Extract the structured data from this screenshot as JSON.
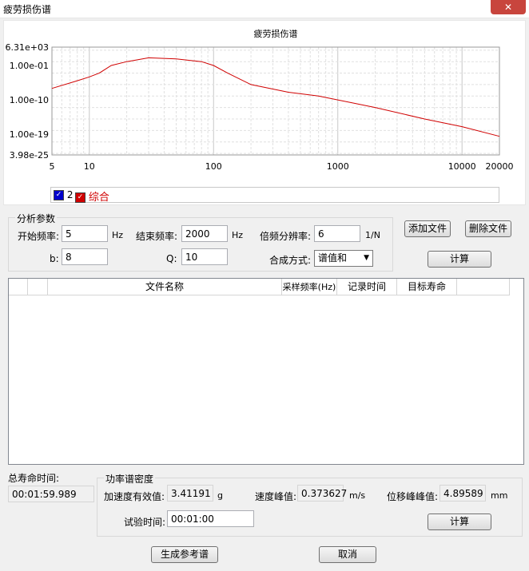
{
  "window": {
    "title": "疲劳损伤谱",
    "close_icon": "close-icon"
  },
  "chart_data": {
    "type": "line",
    "title": "疲劳损伤谱",
    "x_scale": "log",
    "y_scale": "log",
    "xlim": [
      5,
      20000
    ],
    "ylim": [
      3.98e-25,
      6310.0
    ],
    "x_ticks": [
      "5",
      "10",
      "100",
      "1000",
      "10000",
      "20000"
    ],
    "y_ticks": [
      "6.31e+03",
      "1.00e-01",
      "1.00e-10",
      "1.00e-19",
      "3.98e-25"
    ],
    "series": [
      {
        "color": "#d00000",
        "points": [
          [
            5,
            1e-07
          ],
          [
            8,
            1e-05
          ],
          [
            10,
            0.0001
          ],
          [
            12,
            0.001
          ],
          [
            15,
            0.1
          ],
          [
            20,
            1
          ],
          [
            30,
            10
          ],
          [
            50,
            5
          ],
          [
            80,
            1
          ],
          [
            100,
            0.1
          ],
          [
            130,
            0.001
          ],
          [
            200,
            1e-06
          ],
          [
            400,
            1e-08
          ],
          [
            700,
            1e-09
          ],
          [
            1000,
            1e-10
          ],
          [
            2000,
            1e-12
          ],
          [
            5000,
            1e-15
          ],
          [
            10000,
            1e-17
          ],
          [
            20000,
            3e-20
          ]
        ]
      }
    ],
    "grid": true
  },
  "legend": {
    "items": [
      {
        "label": "2",
        "color": "#0000cc"
      },
      {
        "label": "综合",
        "color": "#d00000"
      }
    ]
  },
  "analysis": {
    "group_label": "分析参数",
    "start_freq_label": "开始频率:",
    "start_freq": "5",
    "start_unit": "Hz",
    "end_freq_label": "结束频率:",
    "end_freq": "2000",
    "end_unit": "Hz",
    "oct_res_label": "倍频分辨率:",
    "oct_res": "6",
    "oct_unit": "1/N",
    "b_label": "b:",
    "b_value": "8",
    "q_label": "Q:",
    "q_value": "10",
    "combine_label": "合成方式:",
    "combine_value": "谱值和"
  },
  "buttons": {
    "add_file": "添加文件",
    "delete_file": "删除文件",
    "compute": "计算",
    "compute2": "计算",
    "gen_ref": "生成参考谱",
    "cancel": "取消"
  },
  "table": {
    "columns": [
      "文件名称",
      "采样频率(Hz)",
      "记录时间",
      "目标寿命"
    ]
  },
  "life": {
    "label": "总寿命时间:",
    "value": "00:01:59.989"
  },
  "psd": {
    "group_label": "功率谱密度",
    "acc_label": "加速度有效值:",
    "acc_value": "3.41191",
    "acc_unit": "g",
    "vel_label": "速度峰值:",
    "vel_value": "0.373627",
    "vel_unit": "m/s",
    "disp_label": "位移峰峰值:",
    "disp_value": "4.89589",
    "disp_unit": "mm",
    "test_time_label": "试验时间:",
    "test_time": "00:01:00"
  }
}
